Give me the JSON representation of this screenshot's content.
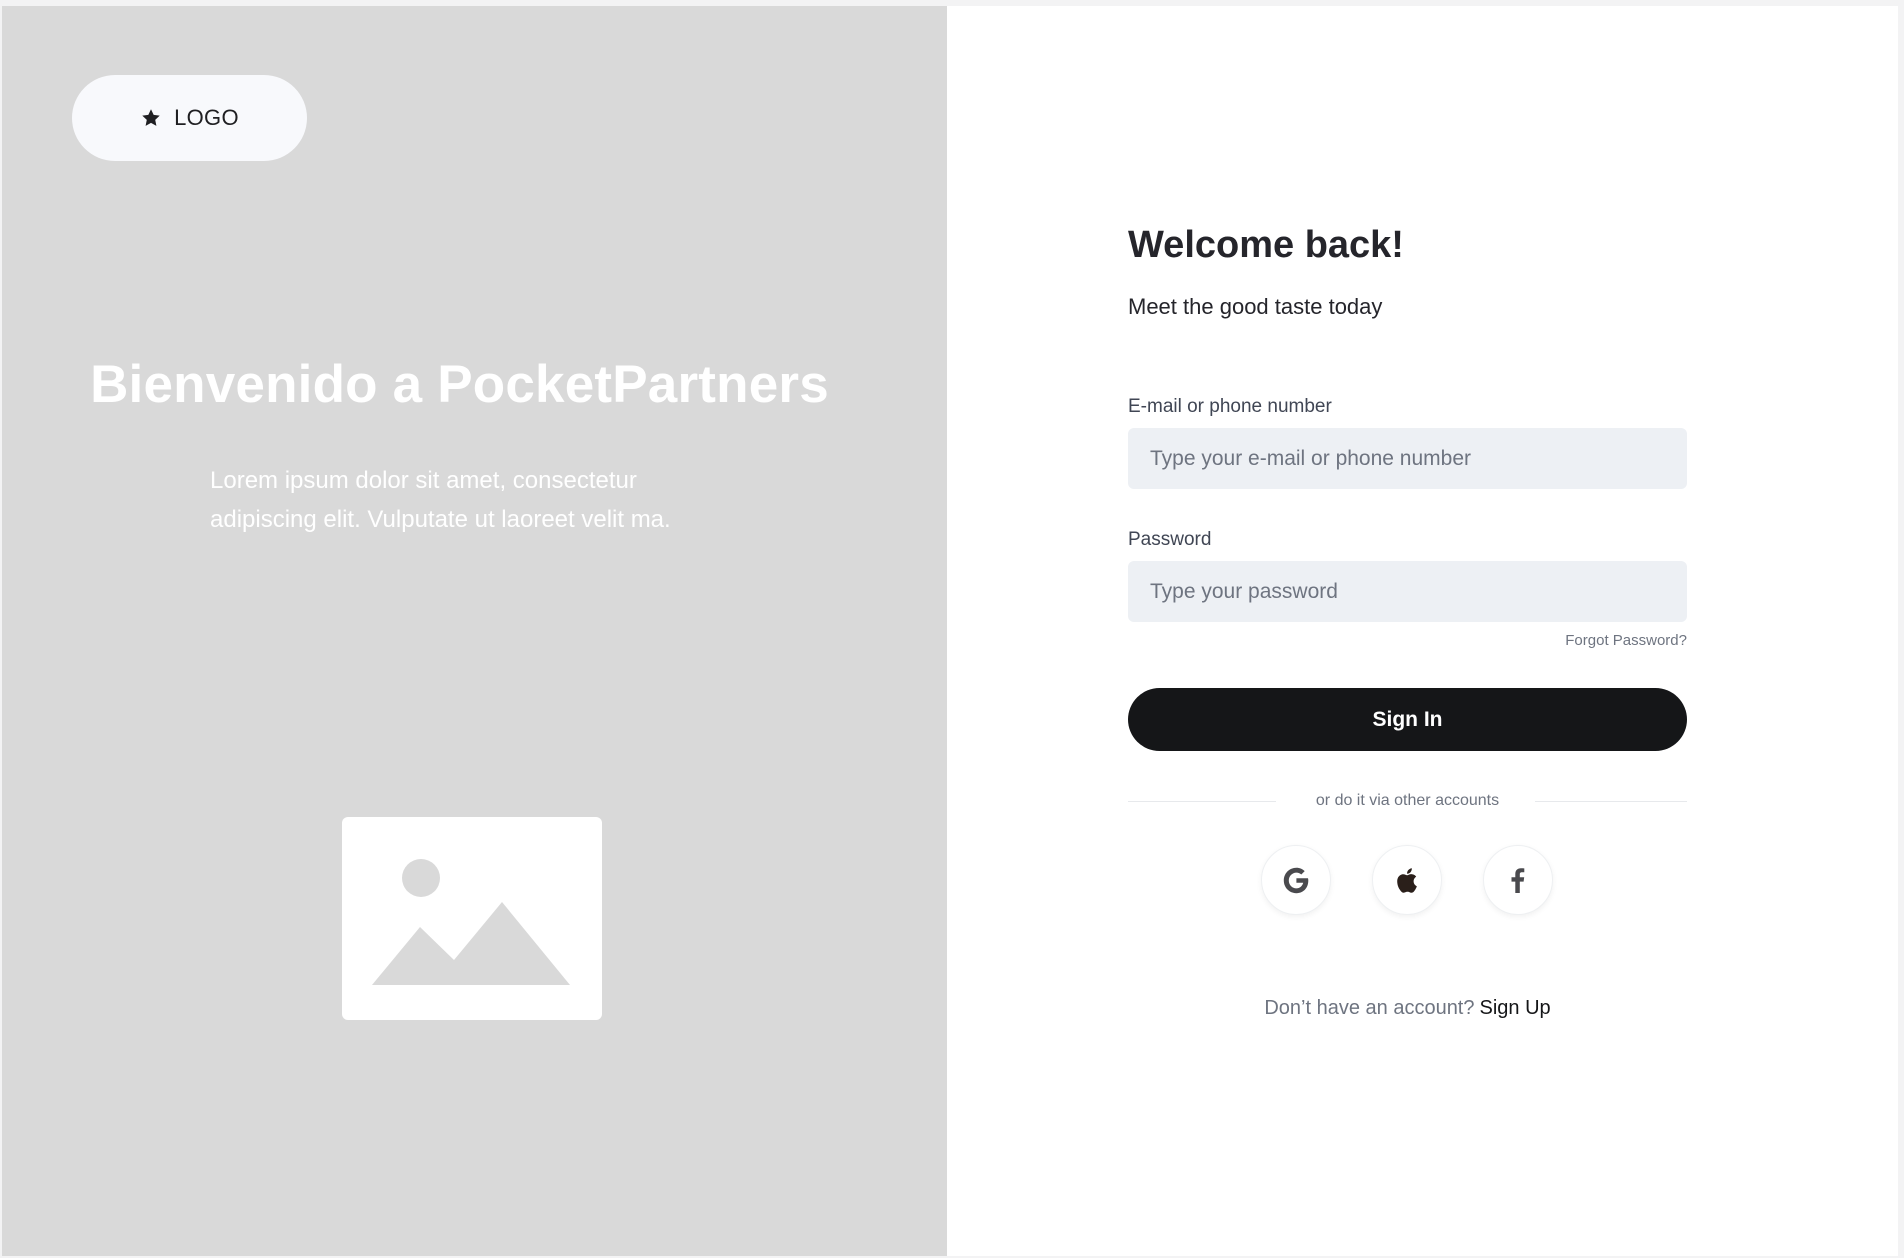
{
  "branding": {
    "logo_text": "LOGO"
  },
  "hero": {
    "title": "Bienvenido a PocketPartners",
    "description": "Lorem ipsum dolor sit amet, consectetur adipiscing elit. Vulputate ut laoreet velit ma."
  },
  "form": {
    "heading": "Welcome back!",
    "subtitle": "Meet the good taste today",
    "email_label": "E-mail or phone number",
    "email_placeholder": "Type your e-mail or phone number",
    "email_value": "",
    "password_label": "Password",
    "password_placeholder": "Type your password",
    "password_value": "",
    "forgot_password": "Forgot Password?",
    "submit_label": "Sign In",
    "divider_text": "or do it via other accounts",
    "social": [
      {
        "icon": "google-icon"
      },
      {
        "icon": "apple-icon"
      },
      {
        "icon": "facebook-icon"
      }
    ],
    "signup_question": "Don’t have an account?",
    "signup_link": "Sign Up"
  },
  "colors": {
    "left_panel_bg": "#d9d9d9",
    "primary_button": "#151618",
    "input_bg": "#edf0f4",
    "muted_text": "#6e7480"
  }
}
